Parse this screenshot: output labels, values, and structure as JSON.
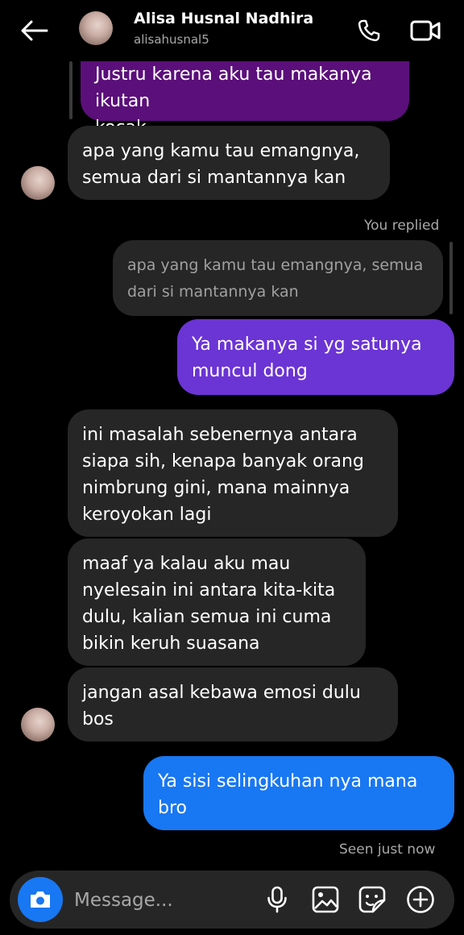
{
  "header": {
    "name": "Alisa Husnal Nadhira",
    "username": "alisahusnal5"
  },
  "messages": [
    {
      "type": "received-reply-continuation",
      "text": "Justru karena aku tau makanya ikutan\nkocak"
    },
    {
      "type": "received",
      "text": "apa yang kamu tau emangnya,\nsemua dari si mantannya kan"
    },
    {
      "type": "reply-label",
      "text": "You replied"
    },
    {
      "type": "quoted",
      "text": "apa yang kamu tau emangnya, semua\ndari si mantannya kan"
    },
    {
      "type": "sent",
      "text": "Ya makanya si yg satunya\nmuncul dong"
    },
    {
      "type": "received",
      "text": "ini masalah sebenernya antara\nsiapa sih, kenapa banyak orang\nnimbrung gini, mana mainnya\nkeroyokan lagi"
    },
    {
      "type": "received",
      "text": "maaf ya kalau aku mau\nnyelesain ini antara kita-kita\ndulu, kalian semua ini cuma\nbikin keruh suasana"
    },
    {
      "type": "received",
      "text": "jangan asal kebawa emosi dulu\nbos"
    },
    {
      "type": "sent",
      "text": "Ya sisi selingkuhan nya mana\nbro"
    }
  ],
  "seen_status": "Seen just now",
  "composer": {
    "placeholder": "Message..."
  },
  "icons": {
    "back": "arrow-left-icon",
    "call": "phone-icon",
    "video": "video-camera-icon",
    "camera": "camera-icon",
    "mic": "microphone-icon",
    "gallery": "image-icon",
    "sticker": "sticker-icon",
    "more": "plus-circle-icon"
  },
  "colors": {
    "background": "#000000",
    "received_bubble": "#262626",
    "sent_purple": "#6b34d4",
    "sent_blue": "#1877f2",
    "reply_purple": "#5b0f7a",
    "secondary_text": "#a8a8a8"
  }
}
